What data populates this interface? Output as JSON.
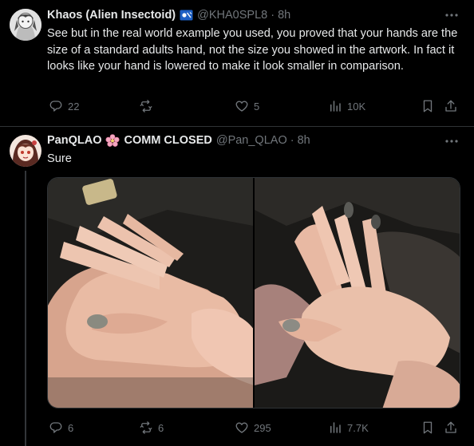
{
  "tweets": [
    {
      "display_name": "Khaos (Alien Insectoid)",
      "badge_icon": "flag-badge-icon",
      "handle": "@KHA0SPL8",
      "separator": "·",
      "time": "8h",
      "text": "See but in the real world example you used, you proved that your hands are the size of a standard adults hand, not the size you showed in the artwork. In fact it looks like your hand is lowered to make it look smaller in comparison.",
      "actions": {
        "reply_count": "22",
        "repost_count": "",
        "like_count": "5",
        "views_count": "10K"
      }
    },
    {
      "display_name": "PanQLAO",
      "badge_icon": "cherry-blossom-icon",
      "display_name_suffix": "COMM CLOSED",
      "handle": "@Pan_QLAO",
      "separator": "·",
      "time": "8h",
      "text": "Sure",
      "media": [
        "hands-photo-left",
        "hands-photo-right"
      ],
      "actions": {
        "reply_count": "6",
        "repost_count": "6",
        "like_count": "295",
        "views_count": "7.7K"
      }
    }
  ],
  "colors": {
    "background": "#000000",
    "text": "#e7e9ea",
    "secondary": "#71767b",
    "divider": "#2f3336"
  }
}
